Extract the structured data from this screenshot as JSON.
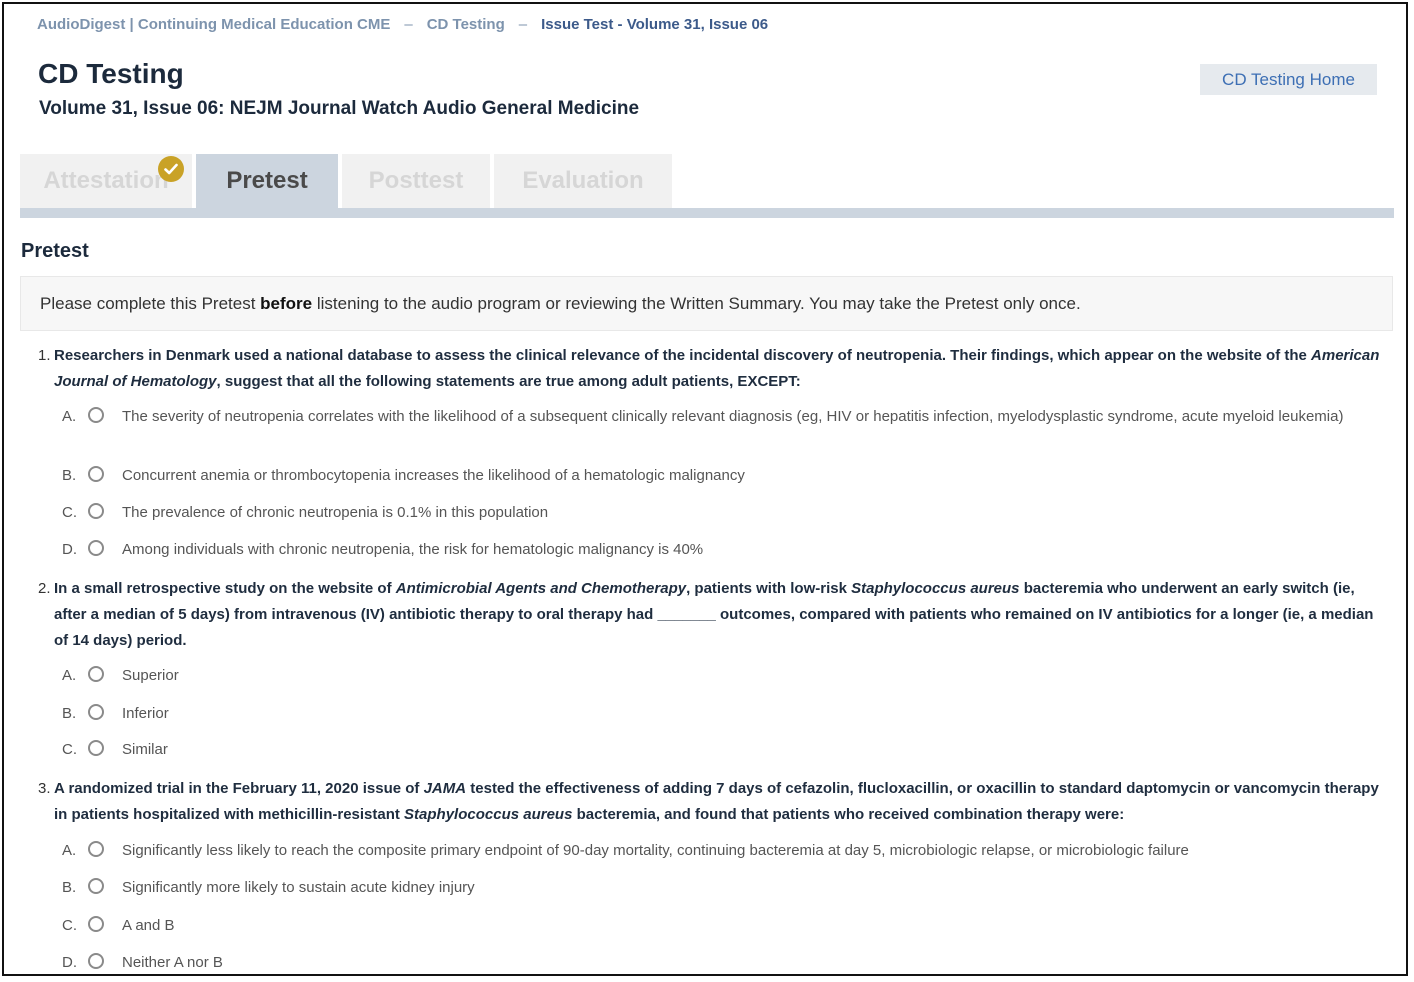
{
  "breadcrumb": {
    "site": "AudioDigest | Continuing Medical Education CME",
    "section": "CD Testing",
    "current": "Issue Test - Volume 31, Issue 06",
    "separator": "–"
  },
  "header": {
    "title": "CD Testing",
    "subtitle": "Volume 31, Issue 06: NEJM Journal Watch Audio General Medicine",
    "home_button": "CD Testing Home"
  },
  "tabs": [
    {
      "label": "Attestation",
      "completed": true
    },
    {
      "label": "Pretest",
      "active": true
    },
    {
      "label": "Posttest"
    },
    {
      "label": "Evaluation"
    }
  ],
  "section": {
    "title": "Pretest",
    "notice_before": "Please complete this Pretest ",
    "notice_bold": "before",
    "notice_after": " listening to the audio program or reviewing the Written Summary. You may take the Pretest only once."
  },
  "questions": [
    {
      "number": "1.",
      "text_parts": [
        "Researchers in Denmark used a national database to assess the clinical relevance of the incidental discovery of neutropenia. Their findings, which appear on the website of the ",
        "American Journal of Hematology",
        ", suggest that all the following statements are true among adult patients, EXCEPT:"
      ],
      "options": [
        {
          "letter": "A.",
          "text": "The severity of neutropenia correlates with the likelihood of a subsequent clinically relevant diagnosis (eg, HIV or hepatitis infection, myelodysplastic syndrome, acute myeloid leukemia)"
        },
        {
          "letter": "B.",
          "text": "Concurrent anemia or thrombocytopenia increases the likelihood of a hematologic malignancy"
        },
        {
          "letter": "C.",
          "text": "The prevalence of chronic neutropenia is 0.1% in this population"
        },
        {
          "letter": "D.",
          "text": "Among individuals with chronic neutropenia, the risk for hematologic malignancy is 40%"
        }
      ]
    },
    {
      "number": "2.",
      "text_parts": [
        "In a small retrospective study on the website of ",
        "Antimicrobial Agents and Chemotherapy",
        ", patients with low-risk ",
        "Staphylococcus aureus",
        " bacteremia who underwent an early switch (ie, after a median of 5 days) from intravenous (IV) antibiotic therapy to oral therapy had _______ outcomes, compared with patients who remained on IV antibiotics for a longer (ie, a median of 14 days) period."
      ],
      "options": [
        {
          "letter": "A.",
          "text": "Superior"
        },
        {
          "letter": "B.",
          "text": "Inferior"
        },
        {
          "letter": "C.",
          "text": "Similar"
        }
      ]
    },
    {
      "number": "3.",
      "text_parts": [
        "A randomized trial in the February 11, 2020 issue of ",
        "JAMA",
        " tested the effectiveness of adding 7 days of cefazolin, flucloxacillin, or oxacillin to standard daptomycin or vancomycin therapy in patients hospitalized with methicillin-resistant ",
        "Staphylococcus aureus",
        " bacteremia, and found that patients who received combination therapy were:"
      ],
      "options": [
        {
          "letter": "A.",
          "text": "Significantly less likely to reach the composite primary endpoint of 90-day mortality, continuing bacteremia at day 5, microbiologic relapse, or microbiologic failure"
        },
        {
          "letter": "B.",
          "text": "Significantly more likely to sustain acute kidney injury"
        },
        {
          "letter": "C.",
          "text": "A and B"
        },
        {
          "letter": "D.",
          "text": "Neither A nor B"
        }
      ]
    }
  ],
  "colors": {
    "tab_active_bg": "#ccd5df",
    "check_badge": "#c9a227",
    "link": "#3d6fb4",
    "heading": "#1c2a3c"
  }
}
